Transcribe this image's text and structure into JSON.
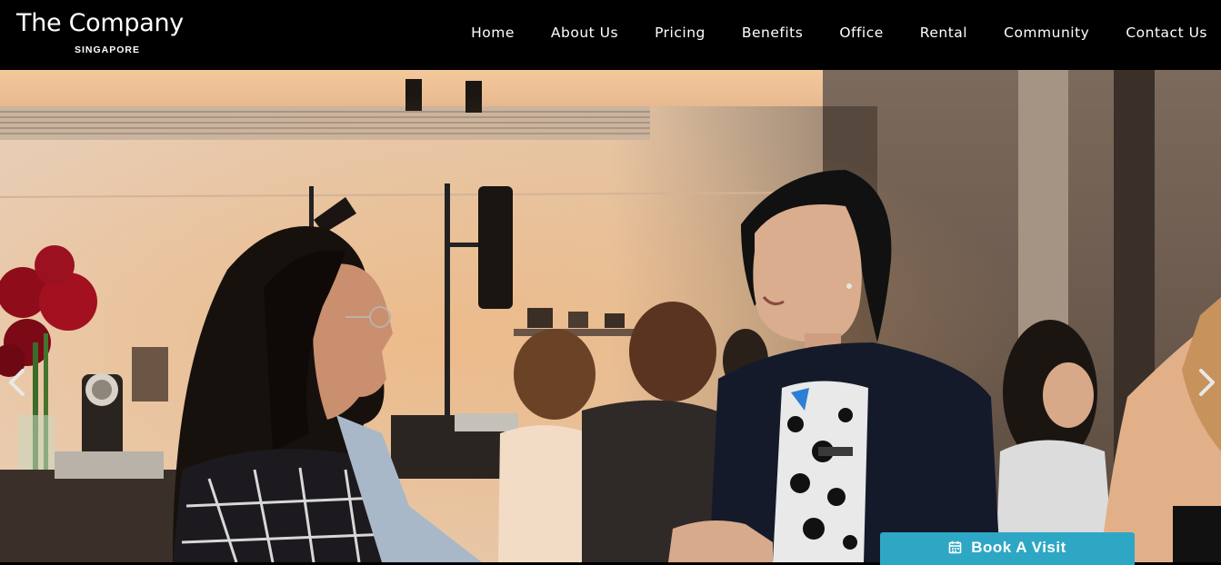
{
  "header": {
    "logo_title": "The Company",
    "logo_subtitle": "SINGAPORE"
  },
  "nav": {
    "items": [
      {
        "label": "Home"
      },
      {
        "label": "About Us"
      },
      {
        "label": "Pricing"
      },
      {
        "label": "Benefits"
      },
      {
        "label": "Office"
      },
      {
        "label": "Rental"
      },
      {
        "label": "Community"
      },
      {
        "label": "Contact Us"
      }
    ]
  },
  "carousel": {
    "prev_icon": "chevron-left-icon",
    "next_icon": "chevron-right-icon"
  },
  "cta": {
    "book_label": "Book A Visit",
    "icon": "calendar-icon",
    "color": "#2ea7c5"
  },
  "colors": {
    "header_bg": "#000000",
    "text": "#ffffff"
  }
}
